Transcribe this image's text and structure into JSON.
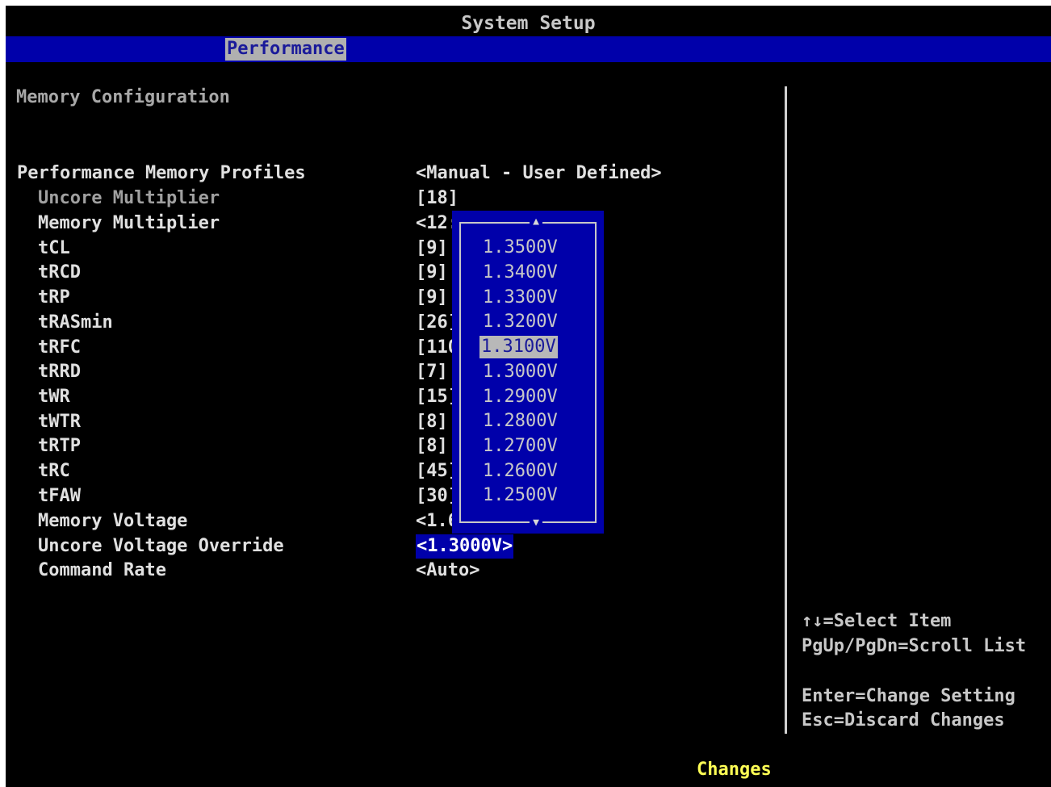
{
  "header": {
    "title": "System Setup",
    "active_tab": "Performance"
  },
  "section": {
    "title": "Memory Configuration"
  },
  "settings": [
    {
      "label": "Performance Memory Profiles",
      "value": "<Manual - User Defined>"
    },
    {
      "label": "Uncore Multiplier",
      "value": "[18]"
    },
    {
      "label": "Memory Multiplier",
      "value": "<12:"
    },
    {
      "label": "tCL",
      "value": "[9]"
    },
    {
      "label": "tRCD",
      "value": "[9]"
    },
    {
      "label": "tRP",
      "value": "[9]"
    },
    {
      "label": "tRASmin",
      "value": "[26]"
    },
    {
      "label": "tRFC",
      "value": "[110"
    },
    {
      "label": "tRRD",
      "value": "[7]"
    },
    {
      "label": "tWR",
      "value": "[15]"
    },
    {
      "label": "tWTR",
      "value": "[8]"
    },
    {
      "label": "tRTP",
      "value": "[8]"
    },
    {
      "label": "tRC",
      "value": "[45]"
    },
    {
      "label": "tFAW",
      "value": "[30]"
    },
    {
      "label": "Memory Voltage",
      "value": "<1.6"
    },
    {
      "label": "Uncore Voltage Override",
      "value": "<1.3000V>"
    },
    {
      "label": "Command Rate",
      "value": "<Auto>"
    }
  ],
  "popup": {
    "options": [
      "1.3500V",
      "1.3400V",
      "1.3300V",
      "1.3200V",
      "1.3100V",
      "1.3000V",
      "1.2900V",
      "1.2800V",
      "1.2700V",
      "1.2600V",
      "1.2500V"
    ],
    "selected_index": 4,
    "scroll_up_icon": "triangle-up",
    "scroll_down_icon": "triangle-down"
  },
  "help": {
    "select_item": "↑↓=Select Item",
    "scroll_list": "PgUp/PgDn=Scroll List",
    "change_setting": "Enter=Change Setting",
    "discard_changes": "Esc=Discard Changes"
  },
  "status": {
    "text": "Changes"
  },
  "colors": {
    "background": "#000000",
    "highlight_blue": "#0000aa",
    "status_yellow": "#ffff55"
  }
}
